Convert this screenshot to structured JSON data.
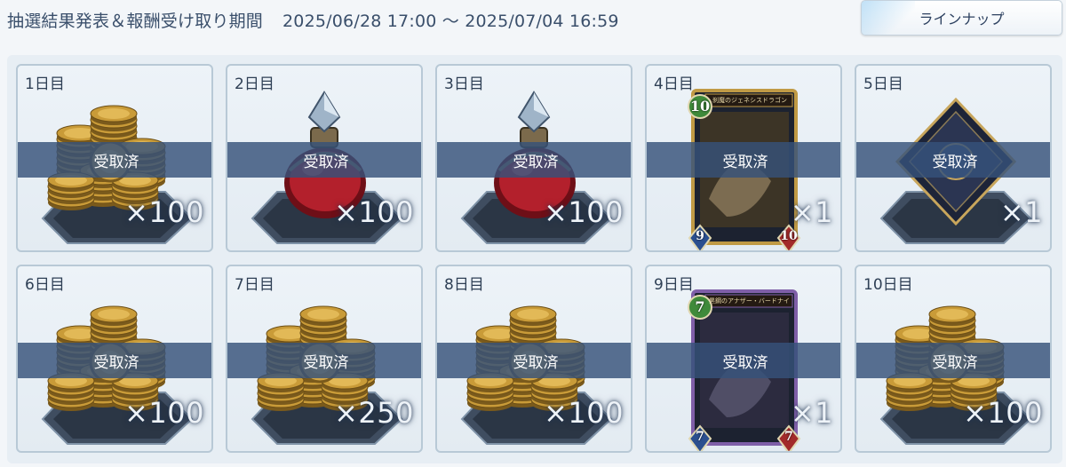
{
  "header": {
    "period_label": "抽選結果発表＆報酬受け取り期間",
    "period_range": "2025/06/28 17:00 ～ 2025/07/04 16:59",
    "lineup_button": "ラインナップ"
  },
  "rewards": [
    {
      "day": "1日目",
      "item": "coins",
      "quantity": "×100",
      "status": "受取済"
    },
    {
      "day": "2日目",
      "item": "potion",
      "quantity": "×100",
      "status": "受取済"
    },
    {
      "day": "3日目",
      "item": "potion",
      "quantity": "×100",
      "status": "受取済"
    },
    {
      "day": "4日目",
      "item": "card",
      "card_name": "刹魔のジェネシスドラゴン",
      "cost": "10",
      "attack": "9",
      "defense": "10",
      "quantity": "×1",
      "status": "受取済"
    },
    {
      "day": "5日目",
      "item": "sleeve",
      "quantity": "×1",
      "status": "受取済"
    },
    {
      "day": "6日目",
      "item": "coins",
      "quantity": "×100",
      "status": "受取済"
    },
    {
      "day": "7日目",
      "item": "coins",
      "quantity": "×250",
      "status": "受取済"
    },
    {
      "day": "8日目",
      "item": "coins",
      "quantity": "×100",
      "status": "受取済"
    },
    {
      "day": "9日目",
      "item": "card",
      "card_name": "黒鋼のアナザー・バードナイト",
      "cost": "7",
      "attack": "7",
      "defense": "7",
      "quantity": "×1",
      "status": "受取済"
    },
    {
      "day": "10日目",
      "item": "coins",
      "quantity": "×100",
      "status": "受取済"
    }
  ],
  "colors": {
    "claimed_band": "#36527a",
    "card_border": "#b8c9d6",
    "card_cost_gem": "#3f8a3a",
    "card_attack_gem": "#2b4f8f",
    "card_defense_gem": "#a22a2a"
  }
}
